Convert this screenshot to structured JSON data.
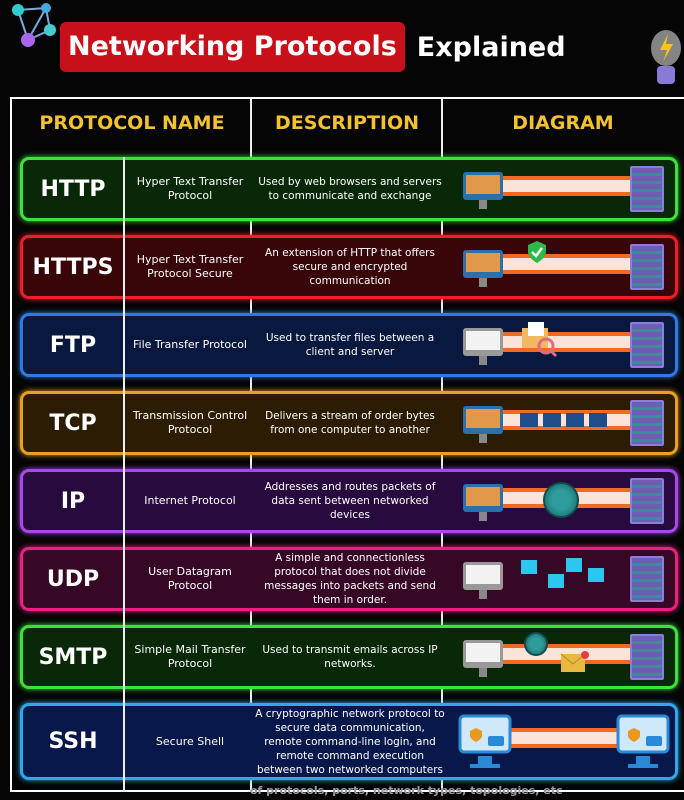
{
  "title": {
    "highlight": "Networking Protocols",
    "rest": "Explained"
  },
  "headers": {
    "name": "PROTOCOL NAME",
    "description": "DESCRIPTION",
    "diagram": "DIAGRAM"
  },
  "rows": [
    {
      "abbr": "HTTP",
      "full": "Hyper Text Transfer Protocol",
      "description": "Used by web browsers and servers to communicate and exchange",
      "border": "#3ee03e",
      "bg": "#082808"
    },
    {
      "abbr": "HTTPS",
      "full": "Hyper Text Transfer Protocol Secure",
      "description": "An extension of HTTP that offers secure and encrypted communication",
      "border": "#e8202a",
      "bg": "#380608"
    },
    {
      "abbr": "FTP",
      "full": "File Transfer Protocol",
      "description": "Used to transfer files between a client and server",
      "border": "#2f7ae0",
      "bg": "#08183e"
    },
    {
      "abbr": "TCP",
      "full": "Transmission Control Protocol",
      "description": "Delivers a stream of order bytes from one computer to another",
      "border": "#e8a020",
      "bg": "#2c1c04"
    },
    {
      "abbr": "IP",
      "full": "Internet Protocol",
      "description": "Addresses and routes packets of data sent between networked devices",
      "border": "#a848e8",
      "bg": "#280a3e"
    },
    {
      "abbr": "UDP",
      "full": "User Datagram Protocol",
      "description": "A simple and connectionless protocol that does not divide messages into packets and send them in order.",
      "border": "#e82080",
      "bg": "#360826"
    },
    {
      "abbr": "SMTP",
      "full": "Simple Mail Transfer Protocol",
      "description": "Used to transmit emails across IP networks.",
      "border": "#3ee03e",
      "bg": "#082808"
    },
    {
      "abbr": "SSH",
      "full": "Secure Shell",
      "description": "A cryptographic network protocol to secure data communication, remote command-line login, and remote command execution between two networked computers",
      "border": "#2fa8e8",
      "bg": "#08184a"
    }
  ],
  "footer_partial": "of protocols, ports, network types, topologies, etc"
}
